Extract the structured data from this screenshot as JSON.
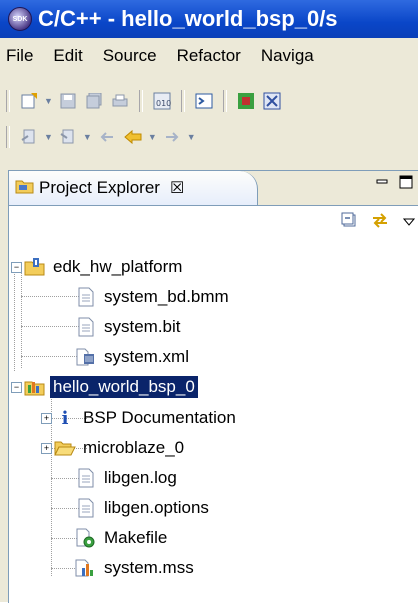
{
  "window": {
    "title": "C/C++ - hello_world_bsp_0/s"
  },
  "menubar": {
    "items": [
      "File",
      "Edit",
      "Source",
      "Refactor",
      "Naviga"
    ]
  },
  "view": {
    "tab_label": "Project Explorer",
    "close_glyph": "☒"
  },
  "tree": {
    "root1": {
      "label": "edk_hw_platform",
      "expanded": true
    },
    "root1_children": [
      "system_bd.bmm",
      "system.bit",
      "system.xml"
    ],
    "root2": {
      "label": "hello_world_bsp_0",
      "expanded": true,
      "selected": true
    },
    "root2_children": [
      "BSP Documentation",
      "microblaze_0",
      "libgen.log",
      "libgen.options",
      "Makefile",
      "system.mss"
    ]
  },
  "colors": {
    "title_blue": "#0a46c8",
    "selection": "#0a246a",
    "chrome": "#ece9d8"
  }
}
